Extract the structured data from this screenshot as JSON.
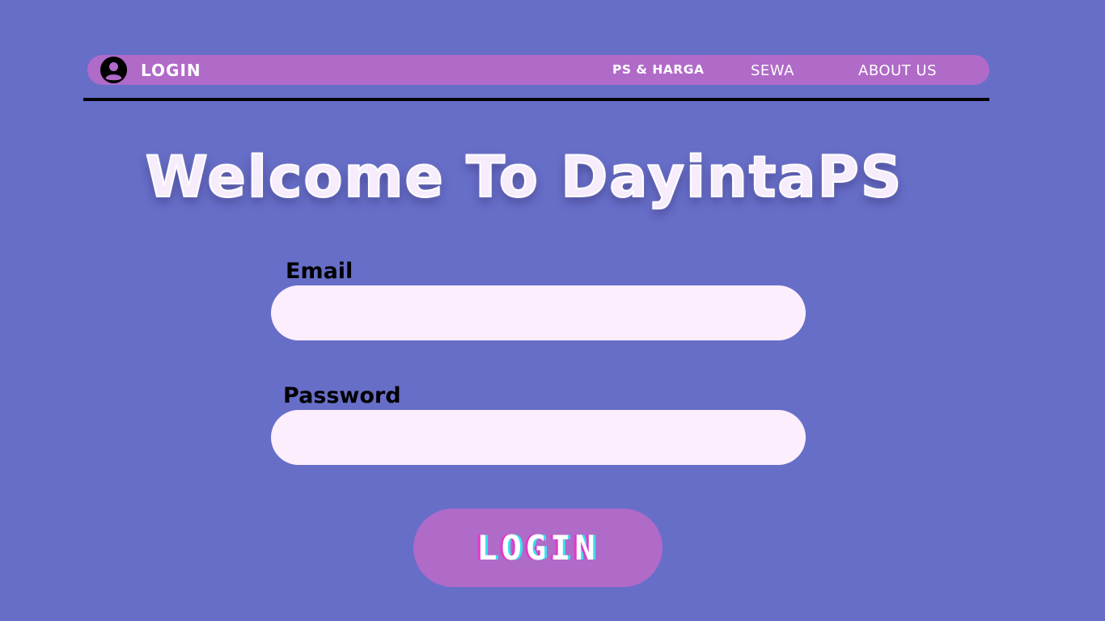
{
  "nav": {
    "user_icon": "user-circle-icon",
    "login_label": "LOGIN",
    "links": [
      {
        "label": "PS & HARGA"
      },
      {
        "label": "SEWA"
      },
      {
        "label": "ABOUT US"
      }
    ]
  },
  "hero": {
    "title": "Welcome To DayintaPS"
  },
  "form": {
    "email_label": "Email",
    "email_value": "",
    "password_label": "Password",
    "password_value": "",
    "submit_label": "LOGIN"
  },
  "colors": {
    "background": "#676ec8",
    "nav_bar": "#b06ac8",
    "input_fill": "#fdeefd",
    "button": "#b06ac8"
  }
}
